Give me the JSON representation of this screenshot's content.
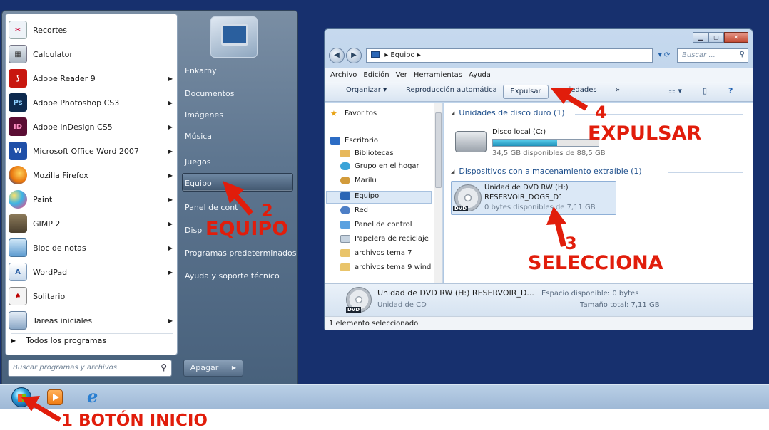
{
  "start_menu": {
    "programs": [
      {
        "label": "Recortes",
        "icon": "scissors-icon",
        "has_arrow": false
      },
      {
        "label": "Calculator",
        "icon": "calculator-icon",
        "has_arrow": false
      },
      {
        "label": "Adobe Reader 9",
        "icon": "adobe-reader-icon",
        "has_arrow": true
      },
      {
        "label": "Adobe Photoshop CS3",
        "icon": "photoshop-icon",
        "has_arrow": true
      },
      {
        "label": "Adobe InDesign CS5",
        "icon": "indesign-icon",
        "has_arrow": true
      },
      {
        "label": "Microsoft Office Word 2007",
        "icon": "word-icon",
        "has_arrow": true
      },
      {
        "label": "Mozilla Firefox",
        "icon": "firefox-icon",
        "has_arrow": true
      },
      {
        "label": "Paint",
        "icon": "paint-icon",
        "has_arrow": true
      },
      {
        "label": "GIMP 2",
        "icon": "gimp-icon",
        "has_arrow": true
      },
      {
        "label": "Bloc de notas",
        "icon": "notepad-icon",
        "has_arrow": true
      },
      {
        "label": "WordPad",
        "icon": "wordpad-icon",
        "has_arrow": true
      },
      {
        "label": "Solitario",
        "icon": "solitaire-icon",
        "has_arrow": false
      },
      {
        "label": "Tareas iniciales",
        "icon": "getting-started-icon",
        "has_arrow": true
      }
    ],
    "icon_badges": {
      "photoshop": "Ps",
      "indesign": "ID",
      "word": "W"
    },
    "all_programs": "Todos los programas",
    "search_placeholder": "Buscar programas y archivos",
    "right_links": {
      "user": "Enkarny",
      "documentos": "Documentos",
      "imagenes": "Imágenes",
      "musica": "Música",
      "juegos": "Juegos",
      "equipo": "Equipo",
      "panel": "Panel de cont",
      "dispositivos": "Disp",
      "predeterminados": "Programas predeterminados",
      "ayuda": "Ayuda y soporte técnico"
    },
    "shutdown": "Apagar"
  },
  "explorer": {
    "address_path": "Equipo",
    "search_placeholder": "Buscar ...",
    "menu": [
      "Archivo",
      "Edición",
      "Ver",
      "Herramientas",
      "Ayuda"
    ],
    "toolbar": {
      "organizar": "Organizar",
      "reproduccion": "Reproducción automática",
      "expulsar": "Expulsar",
      "propiedades": "opiedades",
      "more": "»"
    },
    "nav": [
      {
        "label": "Favoritos",
        "icon": "star-icon"
      },
      {
        "label": "Escritorio",
        "icon": "desktop-icon"
      },
      {
        "label": "Bibliotecas",
        "icon": "libraries-icon"
      },
      {
        "label": "Grupo en el hogar",
        "icon": "homegroup-icon"
      },
      {
        "label": "Marilu",
        "icon": "user-icon"
      },
      {
        "label": "Equipo",
        "icon": "computer-icon"
      },
      {
        "label": "Red",
        "icon": "network-icon"
      },
      {
        "label": "Panel de control",
        "icon": "control-panel-icon"
      },
      {
        "label": "Papelera de reciclaje",
        "icon": "recycle-bin-icon"
      },
      {
        "label": "archivos tema 7",
        "icon": "folder-icon"
      },
      {
        "label": "archivos tema 9 wind",
        "icon": "folder-icon"
      }
    ],
    "groups": {
      "hard_disks": "Unidades de disco duro (1)",
      "removable": "Dispositivos con almacenamiento extraíble (1)"
    },
    "drive_c": {
      "label": "Disco local (C:)",
      "free": "34,5 GB disponibles de 88,5 GB",
      "used_fraction": 0.61
    },
    "dvd": {
      "label": "Unidad de DVD RW (H:)",
      "volume": "RESERVOIR_DOGS_D1",
      "free": "0 bytes disponibles de 7,11 GB",
      "tag": "DVD"
    },
    "details": {
      "title": "Unidad de DVD RW (H:) RESERVOIR_D...",
      "type": "Unidad de CD",
      "space": "Espacio disponible: 0 bytes",
      "total": "Tamaño total: 7,11 GB"
    },
    "status": "1 elemento seleccionado"
  },
  "annotations": {
    "step1": "1 BOTÓN INICIO",
    "step2_num": "2",
    "step2_label": "EQUIPO",
    "step3_num": "3",
    "step3_label": "SELECCIONA",
    "step4_num": "4",
    "step4_label": "EXPULSAR"
  },
  "colors": {
    "annotation": "#e11d0b",
    "desktop": "#17306e"
  }
}
